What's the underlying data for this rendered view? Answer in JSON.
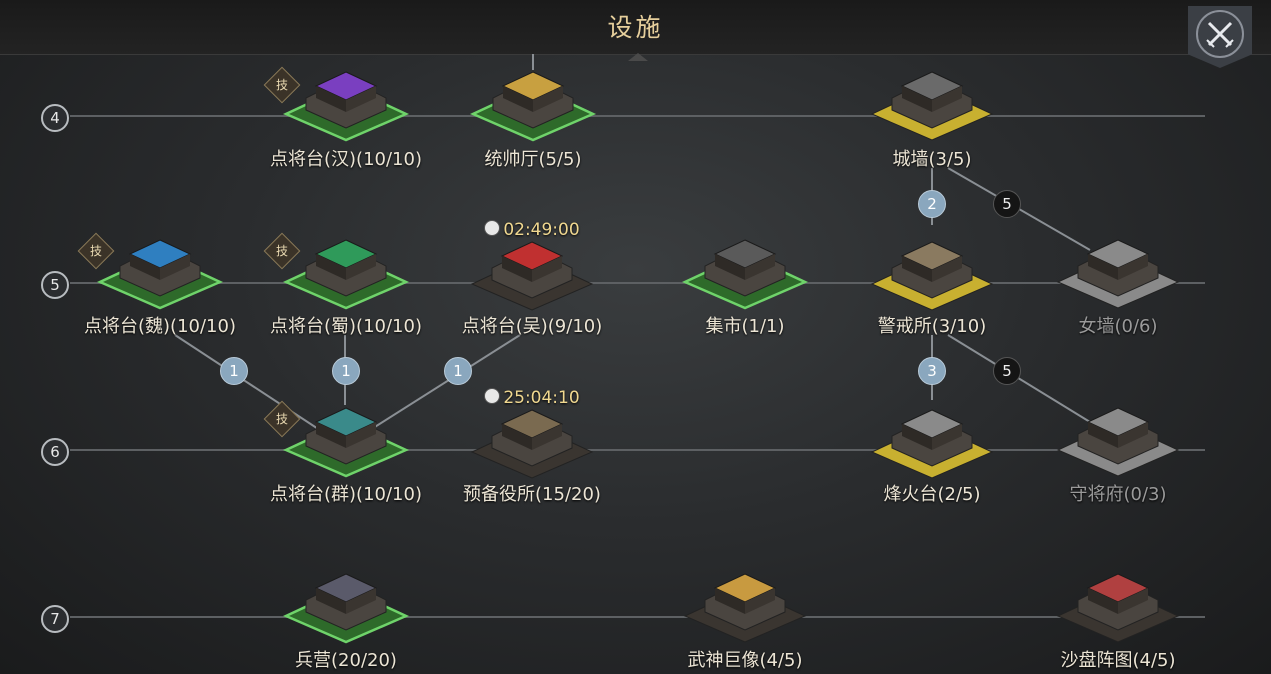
{
  "header": {
    "title": "设施",
    "close_icon": "crossed-swords-icon"
  },
  "rows": [
    {
      "label": "4"
    },
    {
      "label": "5"
    },
    {
      "label": "6"
    },
    {
      "label": "7"
    }
  ],
  "buildings": {
    "dianjiangtai_han": {
      "label": "点将台(汉)(10/10)",
      "tech": "技",
      "roof_color": "#7a3fc0",
      "unlocked": true
    },
    "tongshuaiting": {
      "label": "统帅厅(5/5)",
      "roof_color": "#c8a040",
      "unlocked": true
    },
    "chengqiang": {
      "label": "城墙(3/5)",
      "roof_color": "#6a6a6a",
      "unlocked": true
    },
    "dianjiangtai_wei": {
      "label": "点将台(魏)(10/10)",
      "tech": "技",
      "roof_color": "#2f7fc0",
      "unlocked": true
    },
    "dianjiangtai_shu": {
      "label": "点将台(蜀)(10/10)",
      "tech": "技",
      "roof_color": "#2f9a5a",
      "unlocked": true
    },
    "dianjiangtai_wu": {
      "label": "点将台(吴)(9/10)",
      "timer": "02:49:00",
      "roof_color": "#c03030",
      "unlocked": true
    },
    "jishi": {
      "label": "集市(1/1)",
      "roof_color": "#5a5a5a",
      "unlocked": true
    },
    "jingjiesuo": {
      "label": "警戒所(3/10)",
      "roof_color": "#8a7a60",
      "unlocked": true
    },
    "nvqiang": {
      "label": "女墙(0/6)",
      "roof_color": "#8a8a8a",
      "unlocked": false
    },
    "dianjiangtai_qun": {
      "label": "点将台(群)(10/10)",
      "tech": "技",
      "roof_color": "#3a8a8a",
      "unlocked": true
    },
    "yubeiyisuo": {
      "label": "预备役所(15/20)",
      "timer": "25:04:10",
      "roof_color": "#7a6a50",
      "unlocked": true
    },
    "fenghuotai": {
      "label": "烽火台(2/5)",
      "roof_color": "#8a8a8a",
      "unlocked": true
    },
    "shoujiangfu": {
      "label": "守将府(0/3)",
      "roof_color": "#8a8a8a",
      "unlocked": false
    },
    "bingying": {
      "label": "兵营(20/20)",
      "roof_color": "#5a5a6a",
      "unlocked": true
    },
    "wushenjuxiang": {
      "label": "武神巨像(4/5)",
      "roof_color": "#c89a40",
      "unlocked": true
    },
    "shapanzhentu": {
      "label": "沙盘阵图(4/5)",
      "roof_color": "#b04040",
      "unlocked": true
    }
  },
  "requirements": {
    "wei_to_qun": "1",
    "shu_to_qun": "1",
    "wu_to_qun": "1",
    "wall_to_watch": "2",
    "wall_to_parapet": "5",
    "watch_to_beacon": "3",
    "watch_to_garrison": "5"
  },
  "colors": {
    "unlocked_base": "#2e6a2a",
    "unlocked_glow": "#6fd36a",
    "yellow_base": "#c8b030",
    "locked_base": "#8a8a8a"
  }
}
